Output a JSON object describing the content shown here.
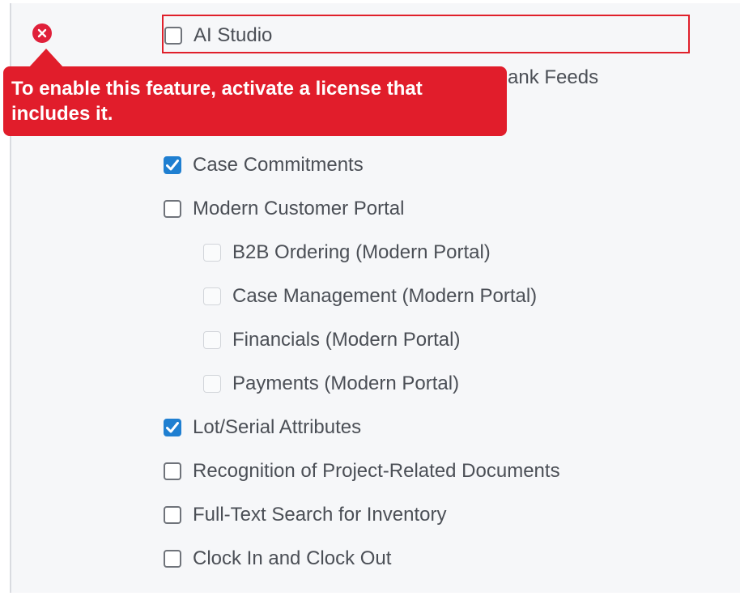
{
  "features": [
    {
      "label": "AI Studio",
      "checked": false,
      "disabled": false
    },
    {
      "label": "Bank Feeds",
      "checked": false,
      "disabled": false
    },
    {
      "label": "Case Commitments",
      "checked": true,
      "disabled": false
    },
    {
      "label": "Modern Customer Portal",
      "checked": false,
      "disabled": false
    },
    {
      "label": "B2B Ordering (Modern Portal)",
      "checked": false,
      "disabled": true
    },
    {
      "label": "Case Management (Modern Portal)",
      "checked": false,
      "disabled": true
    },
    {
      "label": "Financials (Modern Portal)",
      "checked": false,
      "disabled": true
    },
    {
      "label": "Payments (Modern Portal)",
      "checked": false,
      "disabled": true
    },
    {
      "label": "Lot/Serial Attributes",
      "checked": true,
      "disabled": false
    },
    {
      "label": "Recognition of Project-Related Documents",
      "checked": false,
      "disabled": false
    },
    {
      "label": "Full-Text Search for Inventory",
      "checked": false,
      "disabled": false
    },
    {
      "label": "Clock In and Clock Out",
      "checked": false,
      "disabled": false
    }
  ],
  "tooltip": {
    "message": "To enable this feature, activate a license that includes it."
  },
  "colors": {
    "error": "#e11d2b",
    "checked": "#1f7fd1"
  }
}
